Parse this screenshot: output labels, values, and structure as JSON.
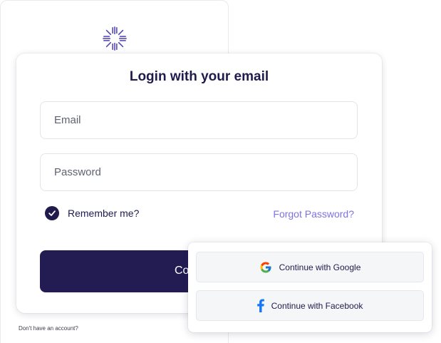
{
  "login": {
    "title": "Login with your email",
    "email_placeholder": "Email",
    "password_placeholder": "Password",
    "remember_label": "Remember me?",
    "remember_checked": true,
    "forgot_label": "Forgot Password?",
    "continue_label": "Co"
  },
  "social": {
    "google_label": "Continue with Google",
    "facebook_label": "Continue with Facebook"
  },
  "footer": {
    "signup_prompt": "Don't have an account?"
  },
  "icons": {
    "logo": "brand-logo-icon",
    "remember": "check-icon",
    "google": "google-icon",
    "facebook": "facebook-icon"
  },
  "colors": {
    "brand_dark": "#221c52",
    "link": "#7b73e6",
    "field_border": "#e3e4ea",
    "social_bg": "#f5f6f8"
  }
}
